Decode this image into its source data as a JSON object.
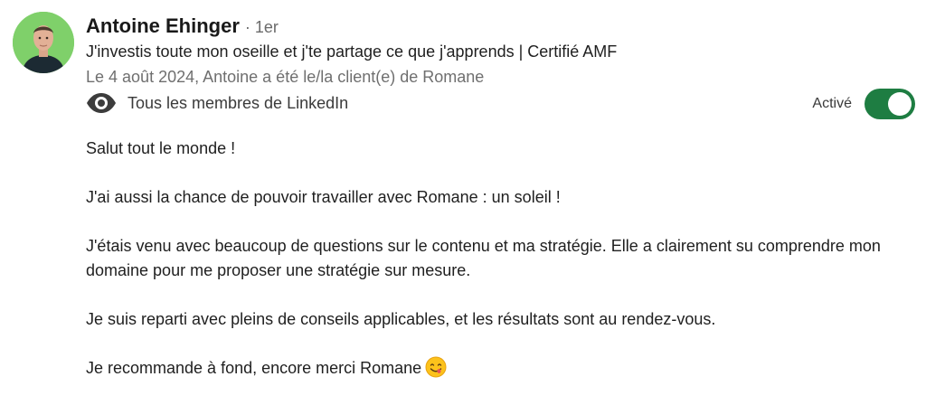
{
  "recommender": {
    "name": "Antoine Ehinger",
    "degree": "· 1er",
    "headline": "J'investis toute mon oseille et j'te partage ce que j'apprends | Certifié AMF",
    "date_line": "Le 4 août 2024, Antoine a été le/la client(e) de Romane"
  },
  "visibility": {
    "label": "Tous les membres de LinkedIn",
    "icon": "eye-icon"
  },
  "toggle": {
    "label": "Activé",
    "state": "on",
    "color": "#1e7d42"
  },
  "recommendation": {
    "paragraphs": [
      "Salut tout le monde !",
      "J'ai aussi la chance de pouvoir travailler avec Romane : un soleil !",
      "J'étais venu avec beaucoup de questions sur le contenu et ma stratégie. Elle a clairement su comprendre mon domaine pour me proposer une stratégie sur mesure.",
      "Je suis reparti avec pleins de conseils applicables, et les résultats sont au rendez-vous.",
      "Je recommande à fond, encore merci Romane"
    ],
    "final_emoji": "smiling-face-emoji"
  }
}
